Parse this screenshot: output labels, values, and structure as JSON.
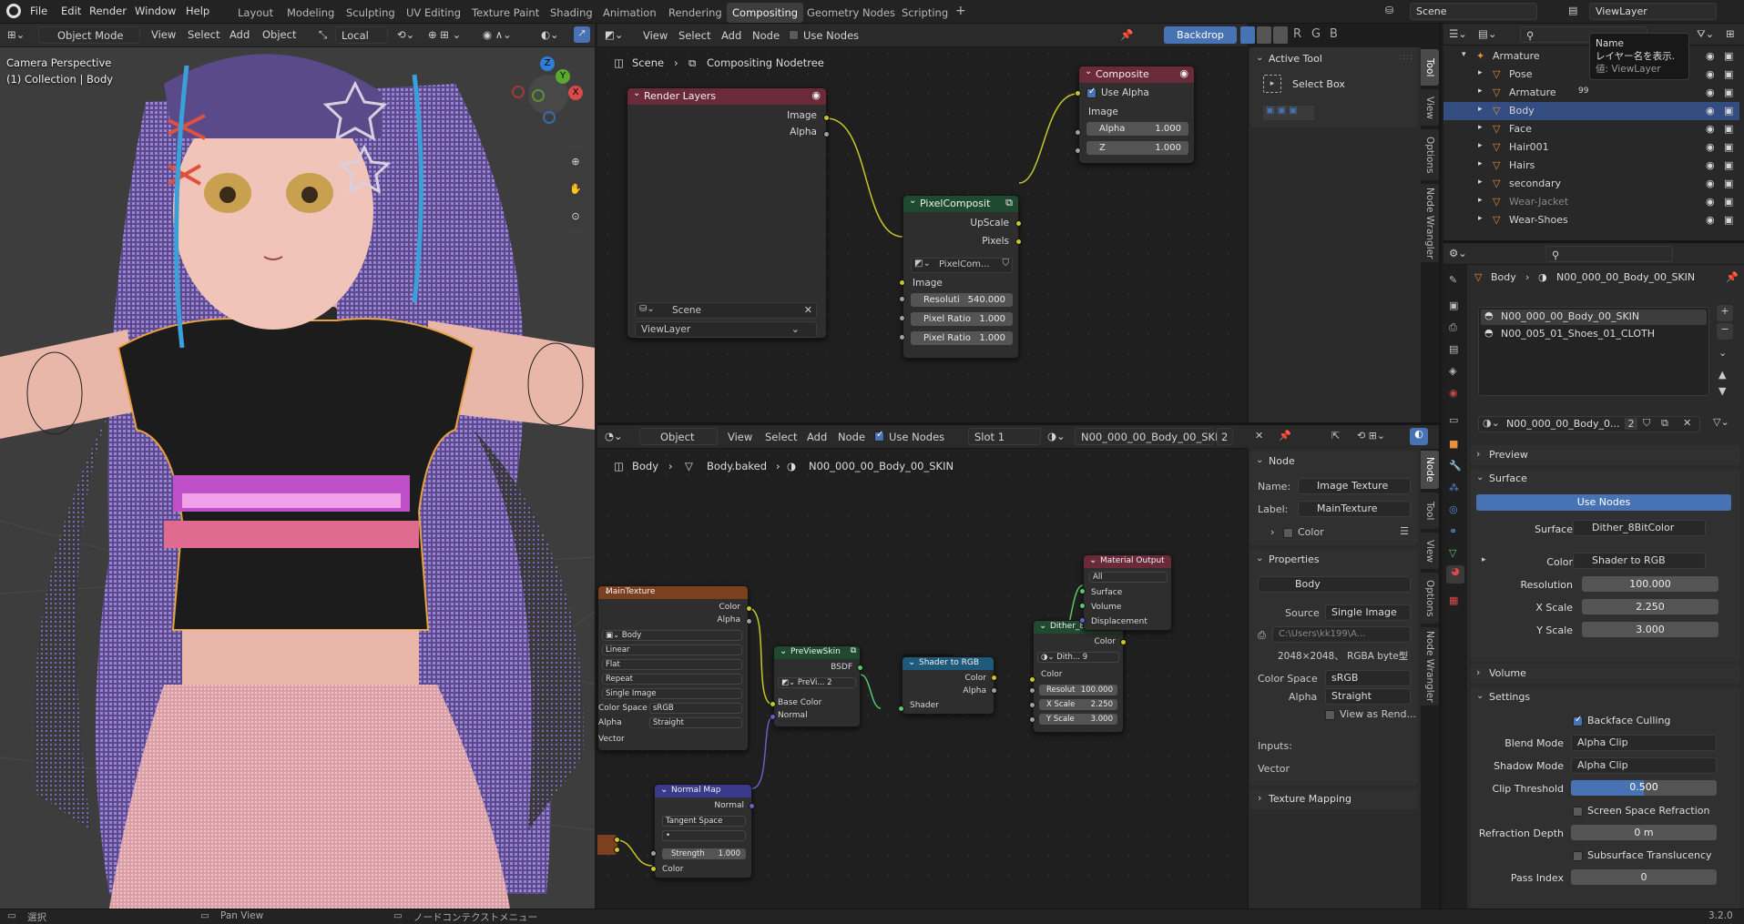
{
  "topbar": {
    "menus": [
      "File",
      "Edit",
      "Render",
      "Window",
      "Help"
    ],
    "workspaces": [
      "Layout",
      "Modeling",
      "Sculpting",
      "UV Editing",
      "Texture Paint",
      "Shading",
      "Animation",
      "Rendering",
      "Compositing",
      "Geometry Nodes",
      "Scripting"
    ],
    "active_workspace": "Compositing",
    "add_tab": "+",
    "scene": "Scene",
    "view_layer": "ViewLayer"
  },
  "viewport": {
    "mode": "Object Mode",
    "menus": [
      "View",
      "Select",
      "Add",
      "Object"
    ],
    "orientation": "Local",
    "overlay_title": "Camera Perspective",
    "overlay_sub": "(1) Collection | Body",
    "gizmo": {
      "z": "Z",
      "y": "Y",
      "x": "X"
    }
  },
  "compositor": {
    "menus": [
      "View",
      "Select",
      "Add",
      "Node"
    ],
    "use_nodes": "Use Nodes",
    "backdrop": "Backdrop",
    "channels": [
      "R",
      "G",
      "B"
    ],
    "breadcrumb": [
      "Scene",
      "Compositing Nodetree"
    ],
    "render_layers": {
      "title": "Render Layers",
      "outputs": [
        "Image",
        "Alpha"
      ],
      "scene": "Scene",
      "view_layer": "ViewLayer"
    },
    "composite": {
      "title": "Composite",
      "use_alpha": "Use Alpha",
      "image": "Image",
      "alpha_label": "Alpha",
      "alpha": "1.000",
      "z_label": "Z",
      "z": "1.000"
    },
    "pixel": {
      "title": "PixelComposit",
      "out1": "UpScale",
      "out2": "Pixels",
      "group": "PixelCom...",
      "image": "Image",
      "res_label": "Resoluti",
      "res": "540.000",
      "pr1_label": "Pixel Ratio",
      "pr1": "1.000",
      "pr2_label": "Pixel Ratio",
      "pr2": "1.000"
    },
    "sidebar": {
      "panel": "Active Tool",
      "tool": "Select Box"
    },
    "tabs": [
      "Tool",
      "View",
      "Options",
      "Node Wrangler"
    ]
  },
  "shader": {
    "editor_type": "Object",
    "menus": [
      "View",
      "Select",
      "Add",
      "Node"
    ],
    "use_nodes": "Use Nodes",
    "slot": "Slot 1",
    "material": "N00_000_00_Body_00_SKIN",
    "users": "2",
    "breadcrumb": [
      "Body",
      "Body.baked",
      "N00_000_00_Body_00_SKIN"
    ],
    "main_texture": {
      "title": "MainTexture",
      "out_color": "Color",
      "out_alpha": "Alpha",
      "image": "Body",
      "interp": "Linear",
      "proj": "Flat",
      "ext": "Repeat",
      "source": "Single Image",
      "cs_label": "Color Space",
      "cs": "sRGB",
      "alpha_label": "Alpha",
      "alpha": "Straight",
      "vector": "Vector"
    },
    "normal_map": {
      "title": "Normal Map",
      "out": "Normal",
      "space": "Tangent Space",
      "strength_label": "Strength",
      "strength": "1.000",
      "color": "Color"
    },
    "preview": {
      "title": "PreViewSkin",
      "out": "BSDF",
      "group": "PreVi...",
      "users": "2",
      "base": "Base Color",
      "normal": "Normal"
    },
    "s2rgb": {
      "title": "Shader to RGB",
      "color": "Color",
      "alpha": "Alpha",
      "shader": "Shader"
    },
    "dither": {
      "title": "Dither_8BitColor",
      "out": "Color",
      "group": "Dith...",
      "users": "9",
      "color": "Color",
      "res_label": "Resolut",
      "res": "100.000",
      "xs_label": "X Scale",
      "xs": "2.250",
      "ys_label": "Y Scale",
      "ys": "3.000"
    },
    "matout": {
      "title": "Material Output",
      "target": "All",
      "surface": "Surface",
      "volume": "Volume",
      "disp": "Displacement"
    },
    "sidebar": {
      "panel": "Node",
      "name_label": "Name:",
      "name": "Image Texture",
      "label_label": "Label:",
      "label": "MainTexture",
      "color": "Color",
      "properties": "Properties",
      "image": "Body",
      "source_label": "Source",
      "source": "Single Image",
      "path": "C:\\Users\\kk199\\A...",
      "info": "2048×2048、 RGBA byte型",
      "cs_label": "Color Space",
      "cs": "sRGB",
      "alpha_label": "Alpha",
      "alpha": "Straight",
      "view_as": "View as Rend...",
      "inputs": "Inputs:",
      "vector": "Vector",
      "texmap": "Texture Mapping"
    },
    "tabs": [
      "Node",
      "Tool",
      "View",
      "Options",
      "Node Wrangler"
    ]
  },
  "outliner": {
    "tooltip": [
      "Name",
      "レイヤー名を表示.",
      "値: ViewLayer"
    ],
    "rows": [
      {
        "label": "Armature",
        "indent": 1
      },
      {
        "label": "Pose",
        "indent": 2
      },
      {
        "label": "Armature",
        "indent": 2,
        "extra": "99"
      },
      {
        "label": "Body",
        "indent": 2,
        "selected": true
      },
      {
        "label": "Face",
        "indent": 2
      },
      {
        "label": "Hair001",
        "indent": 2
      },
      {
        "label": "Hairs",
        "indent": 2
      },
      {
        "label": "secondary",
        "indent": 2
      },
      {
        "label": "Wear-Jacket",
        "indent": 2,
        "dim": true
      },
      {
        "label": "Wear-Shoes",
        "indent": 2
      }
    ]
  },
  "properties": {
    "breadcrumb": [
      "Body",
      "N00_000_00_Body_00_SKIN"
    ],
    "slots": [
      "N00_000_00_Body_00_SKIN",
      "N00_005_01_Shoes_01_CLOTH"
    ],
    "material": "N00_000_00_Body_0...",
    "users": "2",
    "preview": "Preview",
    "surface_panel": "Surface",
    "use_nodes": "Use Nodes",
    "surface_label": "Surface",
    "surface": "Dither_8BitColor",
    "color_label": "Color",
    "color": "Shader to RGB",
    "res_label": "Resolution",
    "res": "100.000",
    "xs_label": "X Scale",
    "xs": "2.250",
    "ys_label": "Y Scale",
    "ys": "3.000",
    "volume": "Volume",
    "settings": "Settings",
    "backface": "Backface Culling",
    "blend_label": "Blend Mode",
    "blend": "Alpha Clip",
    "shadow_label": "Shadow Mode",
    "shadow": "Alpha Clip",
    "clip_label": "Clip Threshold",
    "clip": "0.500",
    "clip_value": 0.5,
    "ssr": "Screen Space Refraction",
    "refr_label": "Refraction Depth",
    "refr": "0 m",
    "sss": "Subsurface Translucency",
    "pass_label": "Pass Index",
    "pass": "0"
  },
  "status": {
    "select": "選択",
    "pan": "Pan View",
    "ctx": "ノードコンテクストメニュー",
    "version": "3.2.0"
  },
  "colors": {
    "accent": "#4772b3",
    "yellow_socket": "#c7c729",
    "green_socket": "#5bc76b",
    "selected_row": "#334d80"
  }
}
